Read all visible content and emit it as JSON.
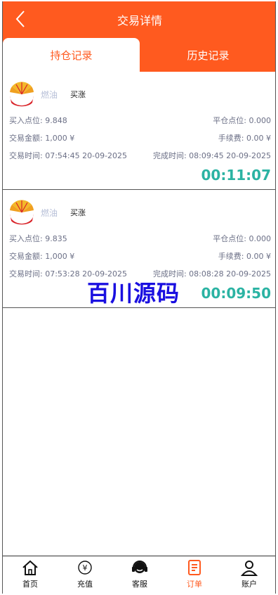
{
  "header": {
    "title": "交易详情"
  },
  "tabs": [
    {
      "label": "持仓记录"
    },
    {
      "label": "历史记录"
    }
  ],
  "orders": [
    {
      "product": "燃油",
      "direction": "买涨",
      "buy_point_label": "买入点位:",
      "buy_point": "9.848",
      "close_point_label": "平仓点位:",
      "close_point": "0.000",
      "amount_label": "交易金额:",
      "amount": "1,000 ¥",
      "fee_label": "手续费:",
      "fee": "0.00 ¥",
      "trade_time_label": "交易时间:",
      "trade_time": "07:54:45 20-09-2025",
      "finish_time_label": "完成时间:",
      "finish_time": "08:09:45 20-09-2025",
      "countdown": "00:11:07"
    },
    {
      "product": "燃油",
      "direction": "买涨",
      "buy_point_label": "买入点位:",
      "buy_point": "9.835",
      "close_point_label": "平仓点位:",
      "close_point": "0.000",
      "amount_label": "交易金额:",
      "amount": "1,000 ¥",
      "fee_label": "手续费:",
      "fee": "0.00 ¥",
      "trade_time_label": "交易时间:",
      "trade_time": "07:53:28 20-09-2025",
      "finish_time_label": "完成时间:",
      "finish_time": "08:08:28 20-09-2025",
      "countdown": "00:09:50"
    }
  ],
  "watermark": "百川源码",
  "tabbar": [
    {
      "label": "首页",
      "icon": "home-icon"
    },
    {
      "label": "充值",
      "icon": "yuan-coin-icon"
    },
    {
      "label": "客服",
      "icon": "headset-icon"
    },
    {
      "label": "订单",
      "icon": "document-icon"
    },
    {
      "label": "账户",
      "icon": "user-icon"
    }
  ],
  "colors": {
    "accent": "#ff5a1f",
    "countdown": "#2bb3a3"
  }
}
